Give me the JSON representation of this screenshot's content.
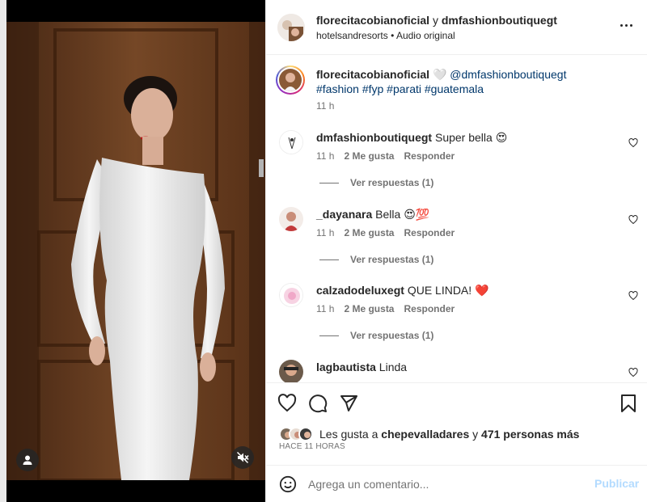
{
  "post": {
    "author": "florecitacobianoficial",
    "connector": "y",
    "collaborator": "dmfashionboutiquegt",
    "location": "hotelsandresorts",
    "separator": "•",
    "audio": "Audio original"
  },
  "caption": {
    "username": "florecitacobianoficial",
    "heart": "🤍",
    "mention": "@dmfashionboutiquegt",
    "hashtags": "#fashion #fyp #parati #guatemala",
    "time": "11 h"
  },
  "comments": [
    {
      "username": "dmfashionboutiquegt",
      "text": "Super bella 😍",
      "time": "11 h",
      "likes": "2 Me gusta",
      "reply": "Responder",
      "view_replies": "Ver respuestas (1)"
    },
    {
      "username": "_dayanara",
      "text": "Bella 😍💯",
      "time": "11 h",
      "likes": "2 Me gusta",
      "reply": "Responder",
      "view_replies": "Ver respuestas (1)"
    },
    {
      "username": "calzadodeluxegt",
      "text": "QUE LINDA! ❤️",
      "time": "11 h",
      "likes": "2 Me gusta",
      "reply": "Responder",
      "view_replies": "Ver respuestas (1)"
    },
    {
      "username": "lagbautista",
      "text": "Linda"
    }
  ],
  "likes": {
    "prefix": "Les gusta a",
    "first_user": "chepevalladares",
    "connector": "y",
    "others": "471 personas más"
  },
  "posted_ago": "HACE 11 HORAS",
  "composer": {
    "placeholder": "Agrega un comentario...",
    "publish": "Publicar"
  },
  "icons": {
    "tagged_people": "person-icon",
    "mute": "speaker-muted-icon",
    "options": "more-options-icon",
    "like": "heart-icon",
    "comment": "comment-icon",
    "share": "paper-plane-icon",
    "save": "bookmark-icon",
    "emoji": "smiley-icon",
    "comment_like": "heart-icon"
  },
  "colors": {
    "link": "#00376b",
    "muted": "#737373",
    "publish_disabled": "#b3dbff"
  }
}
